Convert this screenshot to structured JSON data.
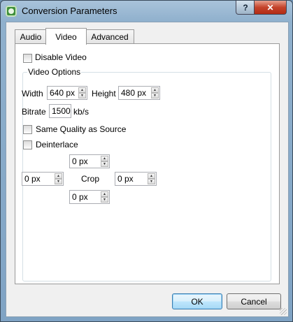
{
  "window": {
    "title": "Conversion Parameters",
    "help_glyph": "?",
    "close_glyph": "✕"
  },
  "tabs": [
    {
      "label": "Audio",
      "active": false
    },
    {
      "label": "Video",
      "active": true
    },
    {
      "label": "Advanced",
      "active": false
    }
  ],
  "video": {
    "disable_label": "Disable Video",
    "disable_checked": false,
    "group_title": "Video Options",
    "width_label": "Width",
    "width_value": "640 px",
    "height_label": "Height",
    "height_value": "480 px",
    "bitrate_label": "Bitrate",
    "bitrate_value": "1500",
    "bitrate_unit": "kb/s",
    "same_quality_label": "Same Quality as Source",
    "same_quality_checked": false,
    "deinterlace_label": "Deinterlace",
    "deinterlace_checked": false,
    "crop_label": "Crop",
    "crop_top": "0 px",
    "crop_left": "0 px",
    "crop_right": "0 px",
    "crop_bottom": "0 px"
  },
  "buttons": {
    "ok": "OK",
    "cancel": "Cancel"
  },
  "icons": {
    "up": "▲",
    "down": "▼"
  }
}
